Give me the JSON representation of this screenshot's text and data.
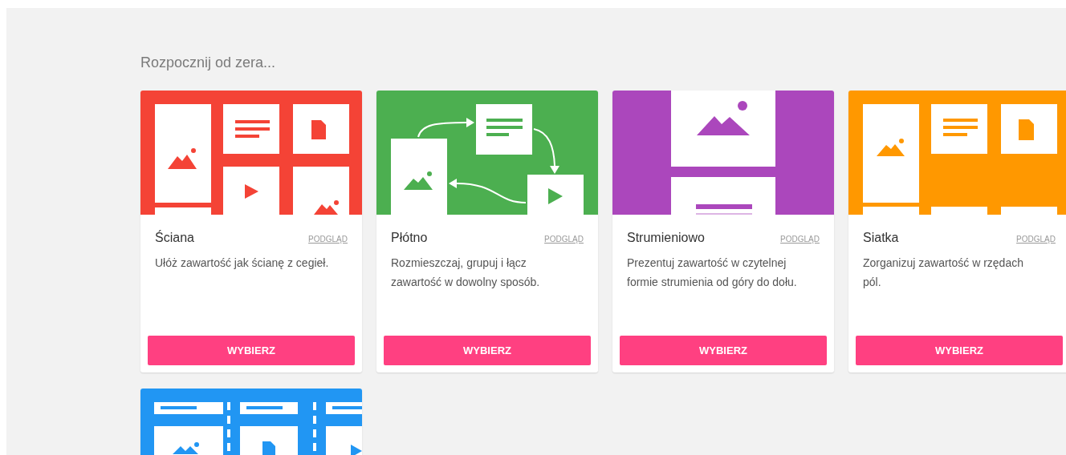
{
  "heading": "Rozpocznij od zera...",
  "cards": [
    {
      "kind": "wall",
      "color": "#f44336",
      "title": "Ściana",
      "preview": "PODGLĄD",
      "description": "Ułóż zawartość jak ścianę z cegieł.",
      "button": "WYBIERZ"
    },
    {
      "kind": "canvas",
      "color": "#4caf50",
      "title": "Płótno",
      "preview": "PODGLĄD",
      "description": "Rozmieszczaj, grupuj i łącz zawartość w dowolny sposób.",
      "button": "WYBIERZ"
    },
    {
      "kind": "stream",
      "color": "#ab47bc",
      "title": "Strumieniowo",
      "preview": "PODGLĄD",
      "description": "Prezentuj zawartość w czytelnej formie strumienia od góry do dołu.",
      "button": "WYBIERZ"
    },
    {
      "kind": "grid",
      "color": "#ff9800",
      "title": "Siatka",
      "preview": "PODGLĄD",
      "description": "Zorganizuj zawartość w rzędach pól.",
      "button": "WYBIERZ"
    },
    {
      "kind": "columns",
      "color": "#2196f3"
    }
  ]
}
